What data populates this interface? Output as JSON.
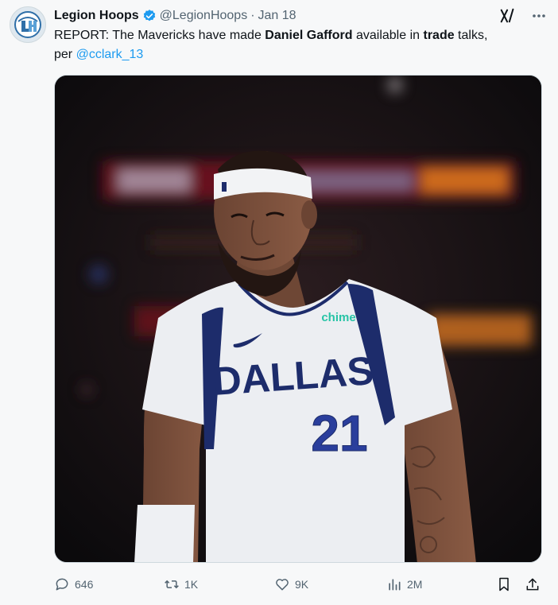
{
  "author": {
    "name": "Legion Hoops",
    "handle": "@LegionHoops",
    "separator": "·",
    "date": "Jan 18",
    "avatar_icon": "legion-hoops-logo",
    "verified_color": "#1d9bf0"
  },
  "tweet": {
    "text_part1": "REPORT: The Mavericks have made ",
    "bold1": "Daniel Gafford",
    "text_part2": " available in ",
    "bold2": "trade",
    "text_part3": " talks,",
    "text_part4": "per ",
    "mention": "@cclark_13"
  },
  "media": {
    "jersey_team": "DALLAS",
    "jersey_number": "21",
    "sponsor": "chime"
  },
  "actions": {
    "replies": "646",
    "reposts": "1K",
    "likes": "9K",
    "views": "2M"
  },
  "colors": {
    "mention": "#1d9bf0",
    "muted": "#536471",
    "jersey_navy": "#1d2c6b"
  }
}
